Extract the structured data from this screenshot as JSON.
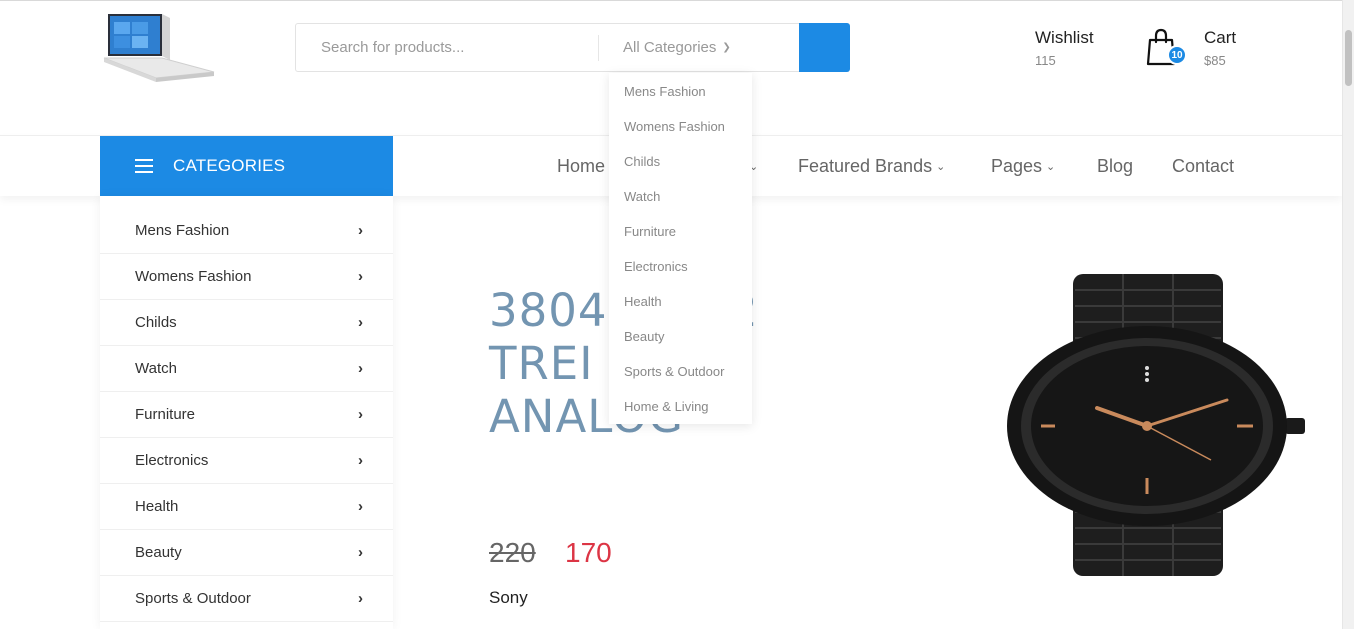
{
  "search": {
    "placeholder": "Search for products...",
    "category_selected": "All Categories",
    "dropdown_options": [
      "Mens Fashion",
      "Womens Fashion",
      "Childs",
      "Watch",
      "Furniture",
      "Electronics",
      "Health",
      "Beauty",
      "Sports & Outdoor",
      "Home & Living"
    ]
  },
  "header": {
    "wishlist_label": "Wishlist",
    "wishlist_count": "115",
    "cart_label": "Cart",
    "cart_amount": "$85",
    "cart_badge": "10"
  },
  "sidebar": {
    "title": "CATEGORIES",
    "items": [
      "Mens Fashion",
      "Womens Fashion",
      "Childs",
      "Watch",
      "Furniture",
      "Electronics",
      "Health",
      "Beauty",
      "Sports & Outdoor"
    ]
  },
  "nav": {
    "items": [
      {
        "label": "Home",
        "has_dropdown": false
      },
      {
        "label": "Featured Brands",
        "has_dropdown": true
      },
      {
        "label": "Pages",
        "has_dropdown": true
      },
      {
        "label": "Blog",
        "has_dropdown": false
      },
      {
        "label": "Contact",
        "has_dropdown": false
      }
    ]
  },
  "hero": {
    "title": "3804      02\nTREI\nANALOG",
    "old_price": "220",
    "new_price": "170",
    "brand": "Sony"
  },
  "colors": {
    "accent": "#1c8ae4",
    "title": "#7395b1",
    "sale": "#dc3545"
  },
  "icons": [
    "laptop-logo",
    "hamburger-icon",
    "chevron-right-icon",
    "chevron-down-icon",
    "shopping-bag-icon",
    "watch-image"
  ]
}
